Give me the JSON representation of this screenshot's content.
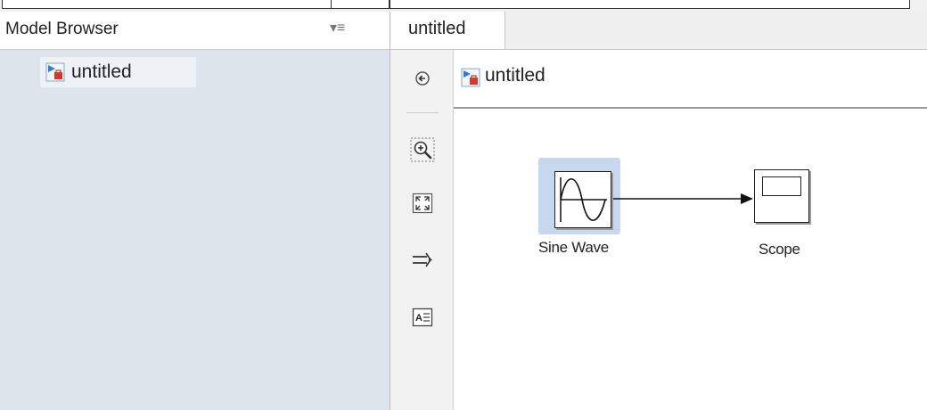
{
  "model_browser": {
    "title": "Model Browser",
    "menu_glyph": "▾≡",
    "tree": [
      {
        "label": "untitled",
        "icon": "simulink-model-icon"
      }
    ]
  },
  "editor": {
    "tab_label": "untitled",
    "address": {
      "label": "untitled",
      "icon": "simulink-model-icon"
    },
    "toolbar": [
      {
        "name": "navigate-back-icon"
      },
      {
        "name": "zoom-in-icon"
      },
      {
        "name": "fit-to-view-icon"
      },
      {
        "name": "route-lines-icon"
      },
      {
        "name": "annotation-icon"
      }
    ]
  },
  "diagram": {
    "blocks": [
      {
        "id": "sine-wave",
        "label": "Sine Wave",
        "selected": true
      },
      {
        "id": "scope",
        "label": "Scope",
        "selected": false
      }
    ],
    "connections": [
      {
        "from": "sine-wave",
        "to": "scope"
      }
    ]
  },
  "colors": {
    "tree_background": "#dde4ec",
    "selection_highlight": "#c7d8ee",
    "model_icon_red": "#d23a2a",
    "model_icon_blue": "#3a7bc8"
  }
}
